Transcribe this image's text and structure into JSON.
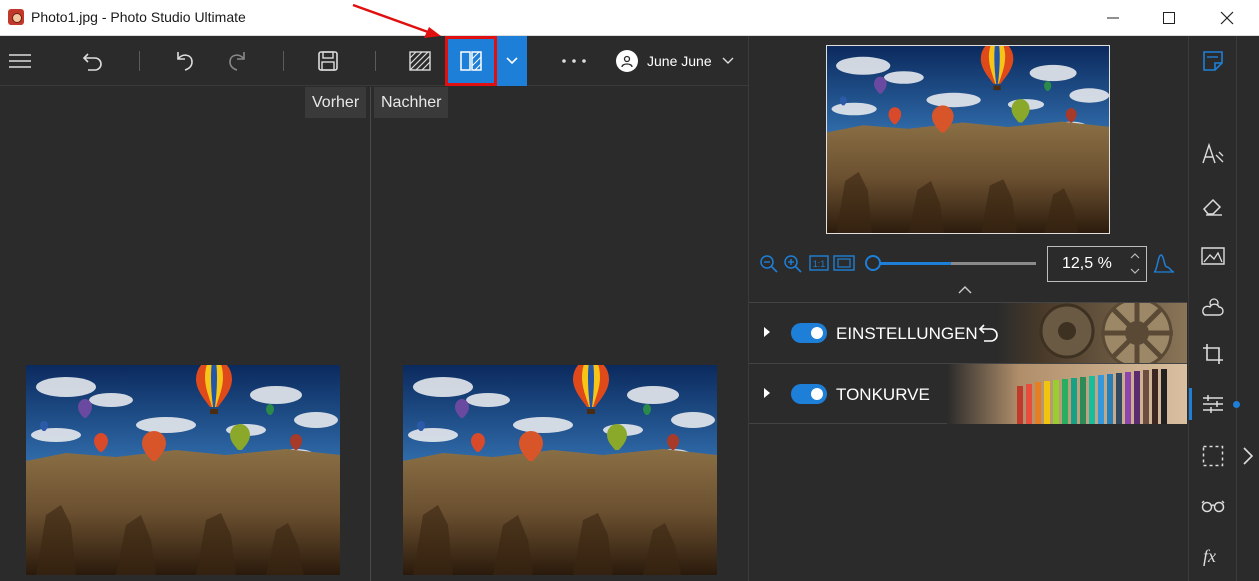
{
  "window": {
    "title": "Photo1.jpg - Photo Studio Ultimate",
    "controls": [
      "minimize-icon",
      "maximize-icon",
      "close-icon"
    ]
  },
  "toolbar": {
    "icons": [
      "menu-icon",
      "reset-icon",
      "undo-icon",
      "redo-icon",
      "save-icon",
      "before-after-icon",
      "split-view-icon",
      "chevron-down-icon",
      "more-icon"
    ],
    "user_name": "June June",
    "accent_color": "#1e7fd8",
    "highlight_color": "#e01010"
  },
  "compare": {
    "before_label": "Vorher",
    "after_label": "Nachher"
  },
  "navigator": {
    "zoom_value": "12,5 %",
    "zoom_icons": [
      "zoom-out-icon",
      "zoom-in-icon",
      "actual-size-icon",
      "fit-icon",
      "histogram-icon"
    ]
  },
  "panels": [
    {
      "label": "EINSTELLUNGEN",
      "enabled": true
    },
    {
      "label": "TONKURVE",
      "enabled": true
    }
  ],
  "sidebar": {
    "items": [
      "edit-icon",
      "text-icon",
      "eraser-icon",
      "image-icon",
      "weather-icon",
      "crop-icon",
      "adjust-icon",
      "selection-icon",
      "glasses-icon",
      "fx-icon"
    ],
    "active": "adjust-icon"
  }
}
